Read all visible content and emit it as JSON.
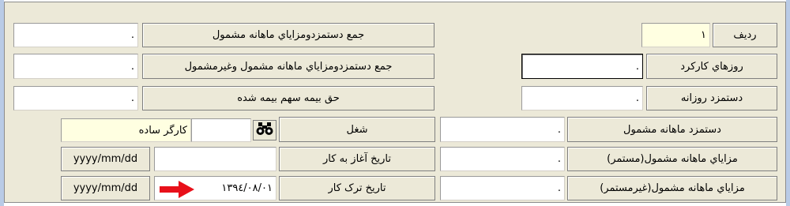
{
  "rows": {
    "radif": {
      "label": "رديف",
      "value": "١"
    },
    "work_days": {
      "label": "روزهاي کارکرد",
      "value": "."
    },
    "daily_wage": {
      "label": "دستمزد روزانه",
      "value": "."
    },
    "monthly_insured_wage": {
      "label": "دستمزد ماهانه مشمول",
      "value": "."
    },
    "monthly_benefits_continuous": {
      "label": "مزاياي ماهانه مشمول(مستمر)",
      "value": "."
    },
    "monthly_benefits_noncontinuous": {
      "label": "مزاياي ماهانه مشمول(غيرمستمر)",
      "value": "."
    },
    "total_insured": {
      "label": "جمع دستمزدومزاياي ماهانه مشمول",
      "value": "."
    },
    "total_insured_and_non": {
      "label": "جمع دستمزدومزاياي ماهانه مشمول وغيرمشمول",
      "value": "."
    },
    "insurance_share": {
      "label": "حق بيمه سهم بيمه شده",
      "value": "."
    },
    "job": {
      "label": "شغل",
      "code": "",
      "name": "کارگر ساده"
    },
    "start_date": {
      "label": "تاريخ آغاز به کار",
      "value": "",
      "format": "yyyy/mm/dd"
    },
    "end_date": {
      "label": "تاريخ ترک کار",
      "value": "١٣٩٤/٠٨/٠١",
      "format": "yyyy/mm/dd"
    }
  },
  "icons": {
    "binoculars": "binoculars-icon",
    "arrow": "red-arrow-icon"
  },
  "colors": {
    "panel": "#ece9d8",
    "yellow_field": "#ffffe1",
    "arrow": "#e8101a"
  }
}
